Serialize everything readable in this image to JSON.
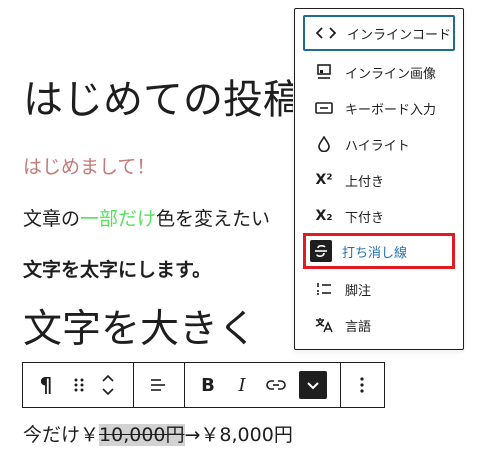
{
  "editor": {
    "title": "はじめての投稿",
    "p1": "はじめまして！",
    "p2_before": "文章の",
    "p2_green": "一部だけ",
    "p2_after": "色を変えたい",
    "p3": "文字を太字にします。",
    "h2": "文字を大きく",
    "p4_before": "今だけ￥",
    "p4_strike": "10,000円",
    "p4_after": "→￥8,000円"
  },
  "toolbar": {
    "paragraph": "¶",
    "bold": "B",
    "italic": "I"
  },
  "menu": {
    "items": [
      {
        "label": "インラインコード",
        "icon": "code-icon"
      },
      {
        "label": "インライン画像",
        "icon": "inline-image-icon"
      },
      {
        "label": "キーボード入力",
        "icon": "keyboard-icon"
      },
      {
        "label": "ハイライト",
        "icon": "droplet-icon"
      },
      {
        "label": "上付き",
        "icon": "superscript-icon",
        "glyph": "X²"
      },
      {
        "label": "下付き",
        "icon": "subscript-icon",
        "glyph": "X₂"
      },
      {
        "label": "打ち消し線",
        "icon": "strikethrough-icon"
      },
      {
        "label": "脚注",
        "icon": "footnote-icon"
      },
      {
        "label": "言語",
        "icon": "language-icon"
      }
    ]
  },
  "colors": {
    "accent": "#1c6e8c",
    "highlight_border": "#e01b24",
    "green_text": "#56e35d",
    "pink_text": "#c27a7a"
  }
}
